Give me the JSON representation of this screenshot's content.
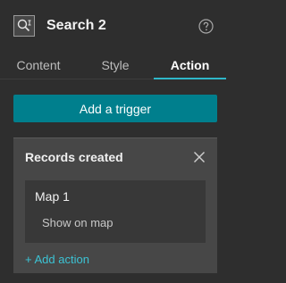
{
  "header": {
    "title": "Search 2",
    "widget_icon": "search-widget-icon",
    "help_icon": "help-circle-icon"
  },
  "tabs": [
    {
      "label": "Content",
      "active": false
    },
    {
      "label": "Style",
      "active": false
    },
    {
      "label": "Action",
      "active": true
    }
  ],
  "add_trigger_label": "Add a trigger",
  "trigger": {
    "title": "Records created",
    "close_icon": "close-icon",
    "action": {
      "target": "Map 1",
      "item": "Show on map"
    },
    "add_action_label": "+ Add action"
  },
  "colors": {
    "background": "#2e2e2e",
    "accent": "#2fb7c9",
    "button": "#007f8d",
    "panel": "#474747",
    "card": "#383838"
  }
}
